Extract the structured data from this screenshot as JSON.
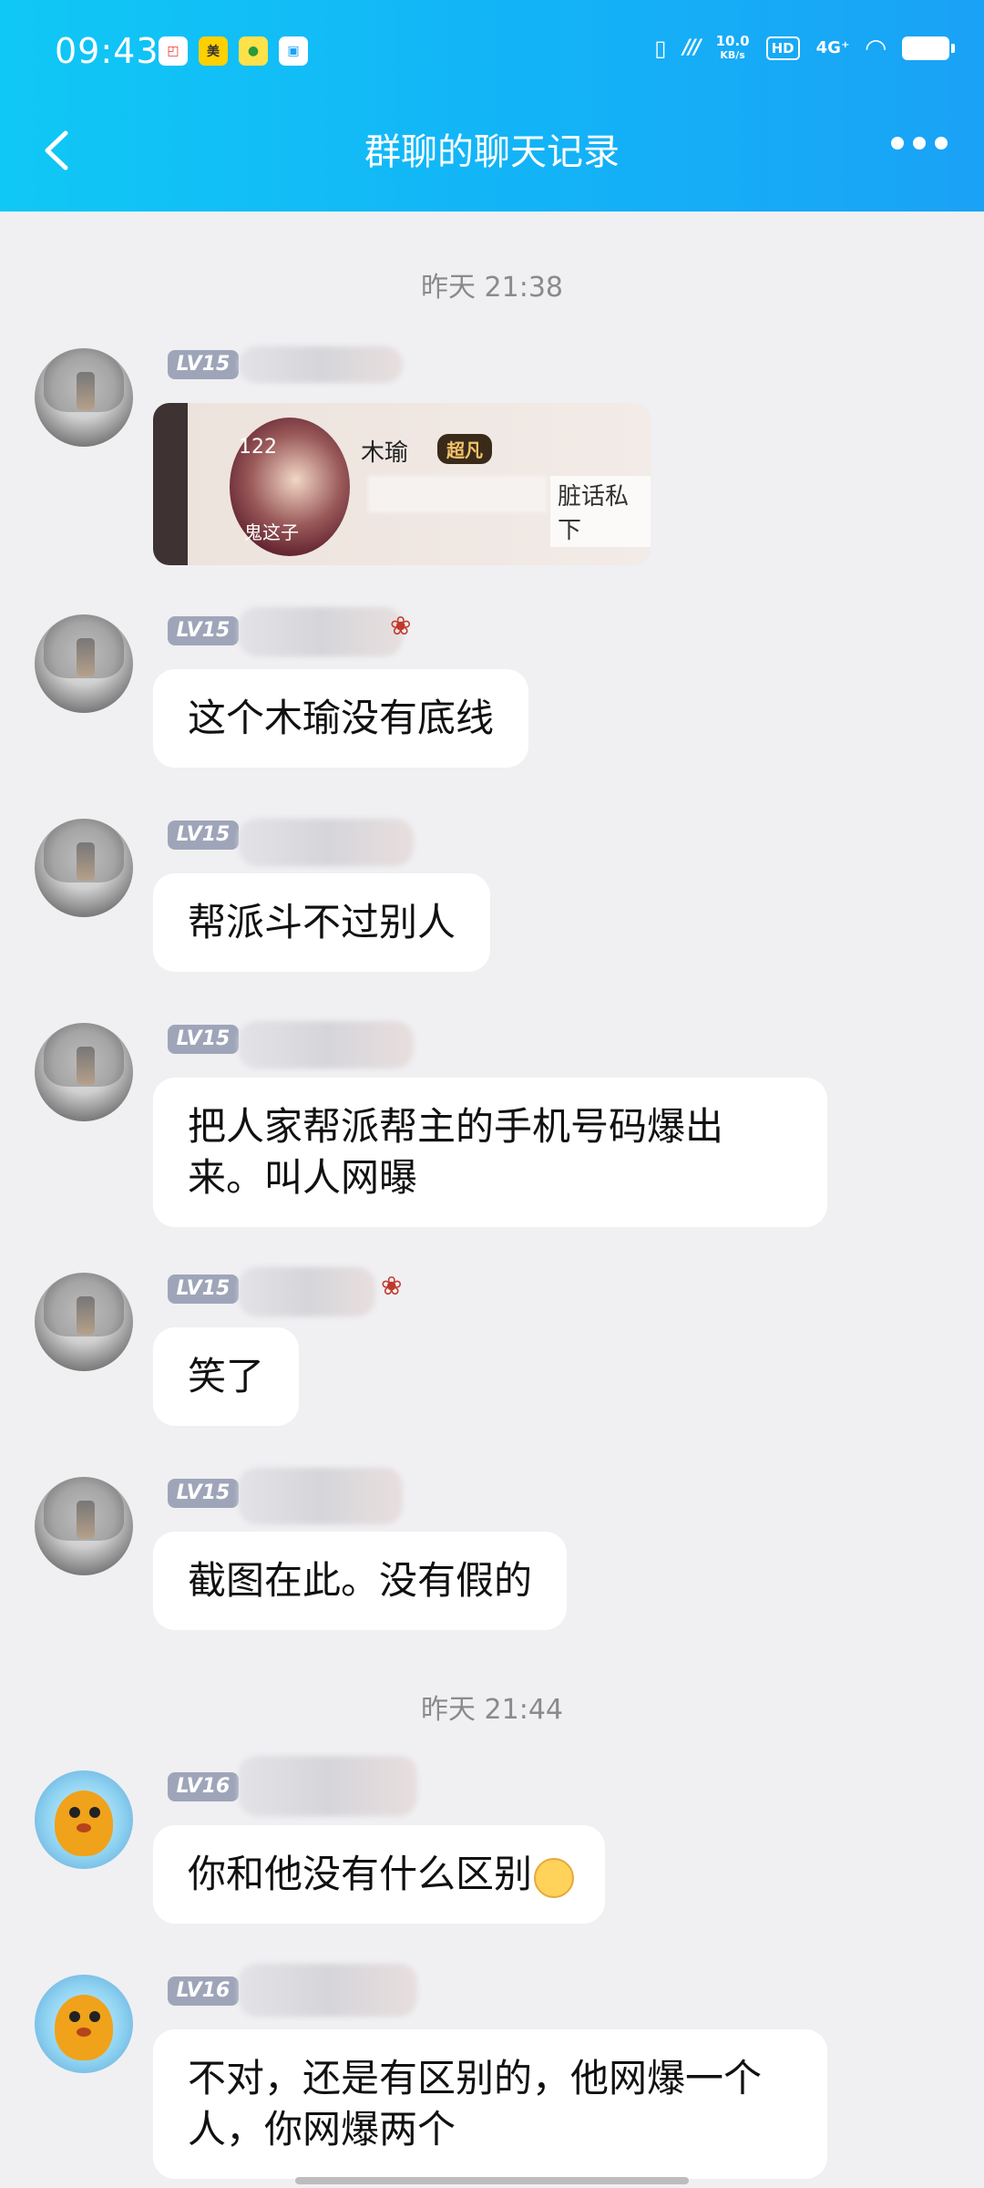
{
  "status_bar": {
    "time": "09:43",
    "net_speed_value": "10.0",
    "net_speed_unit": "KB/s",
    "hd": "HD",
    "network": "4G⁺"
  },
  "nav": {
    "title": "群聊的聊天记录"
  },
  "timestamps": [
    "昨天 21:38",
    "昨天 21:44"
  ],
  "messages": [
    {
      "level": "LV15",
      "type": "image",
      "image_number": "122",
      "image_name": "木瑜",
      "image_tag": "超凡",
      "image_caption": "鬼这子",
      "image_side_text": "脏话私下"
    },
    {
      "level": "LV15",
      "text": "这个木瑜没有底线"
    },
    {
      "level": "LV15",
      "text": "帮派斗不过别人"
    },
    {
      "level": "LV15",
      "text": "把人家帮派帮主的手机号码爆出来。叫人网曝"
    },
    {
      "level": "LV15",
      "text": "笑了"
    },
    {
      "level": "LV15",
      "text": "截图在此。没有假的"
    },
    {
      "level": "LV16",
      "text": "你和他没有什么区别"
    },
    {
      "level": "LV16",
      "text": "不对，还是有区别的，他网爆一个人，你网爆两个"
    }
  ]
}
